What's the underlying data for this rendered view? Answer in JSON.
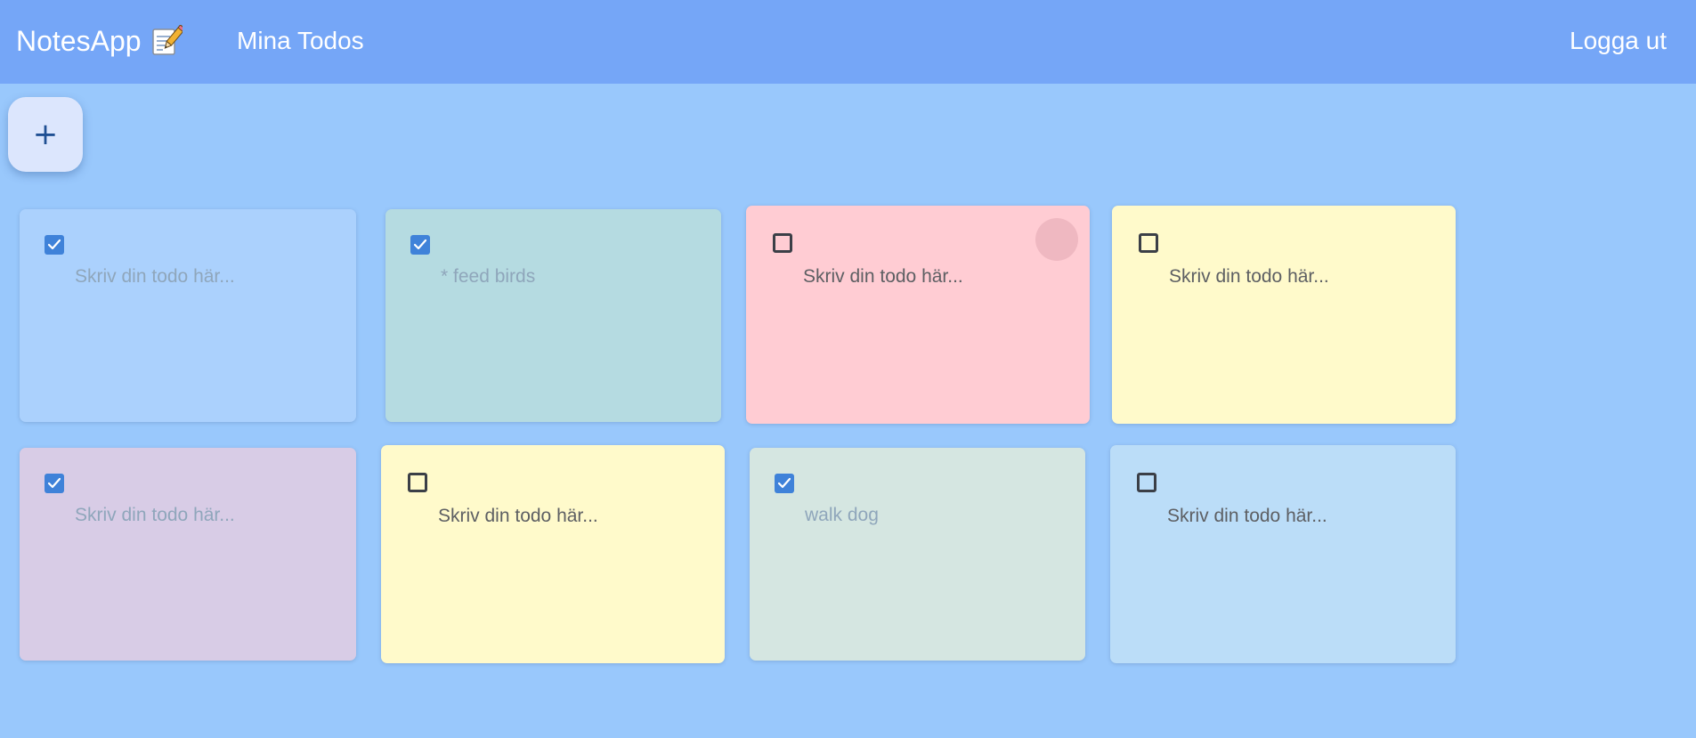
{
  "header": {
    "brand": "NotesApp",
    "brand_icon": "memo-emoji-icon",
    "nav_link": "Mina Todos",
    "logout": "Logga ut"
  },
  "add_button": {
    "label": "+"
  },
  "todos": [
    {
      "text": "Skriv din todo här...",
      "is_placeholder": true,
      "checked": true,
      "color": "#abd1fd"
    },
    {
      "text": "* feed birds",
      "is_placeholder": false,
      "checked": true,
      "color": "#b5dbe1"
    },
    {
      "text": "Skriv din todo här...",
      "is_placeholder": true,
      "checked": false,
      "color": "#ffccd3"
    },
    {
      "text": "Skriv din todo här...",
      "is_placeholder": true,
      "checked": false,
      "color": "#fffacb"
    },
    {
      "text": "Skriv din todo här...",
      "is_placeholder": true,
      "checked": true,
      "color": "#d8cce6"
    },
    {
      "text": "Skriv din todo här...",
      "is_placeholder": true,
      "checked": false,
      "color": "#fffacb"
    },
    {
      "text": "walk dog",
      "is_placeholder": false,
      "checked": true,
      "color": "#d5e6e1"
    },
    {
      "text": "Skriv din todo här...",
      "is_placeholder": true,
      "checked": false,
      "color": "#bbddf8"
    }
  ],
  "colors": {
    "topbar": "#75a6f7",
    "background": "#99c8fc",
    "checkbox_checked": "#3f82d9",
    "text_active": "#5d5f63",
    "text_completed": "#8fa6bb"
  }
}
